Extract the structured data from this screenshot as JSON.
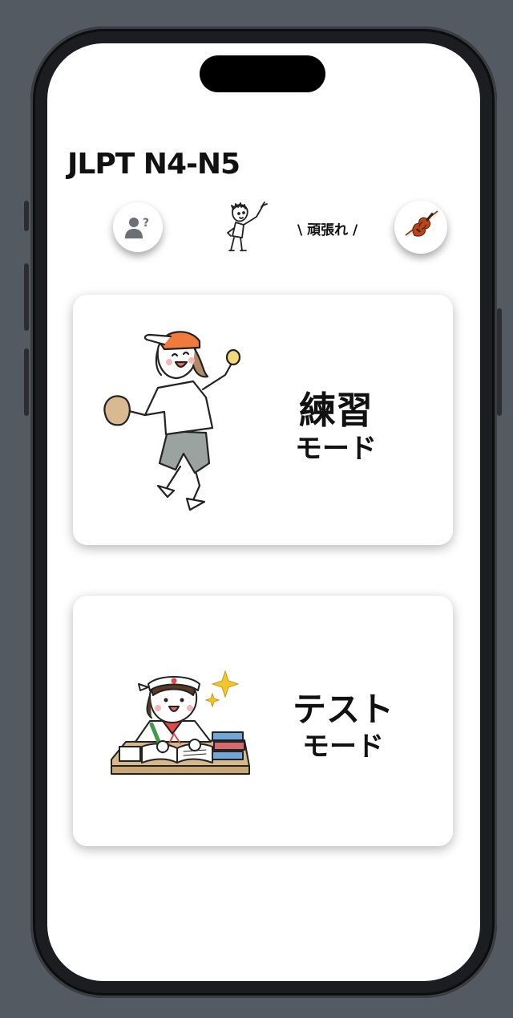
{
  "app": {
    "title": "JLPT N4-N5"
  },
  "header": {
    "help_icon": "person-question-icon",
    "cheer_text": "\\ 頑張れ /",
    "mascot": "pointing-boy-illustration",
    "violin_icon": "violin-icon"
  },
  "modes": [
    {
      "title": "練習",
      "subtitle": "モード",
      "illustration": "baseball-girl-illustration"
    },
    {
      "title": "テスト",
      "subtitle": "モード",
      "illustration": "studying-student-illustration"
    }
  ],
  "colors": {
    "background": "#545a62",
    "screen": "#ffffff",
    "text": "#111111",
    "cap_orange": "#f07a3c"
  }
}
